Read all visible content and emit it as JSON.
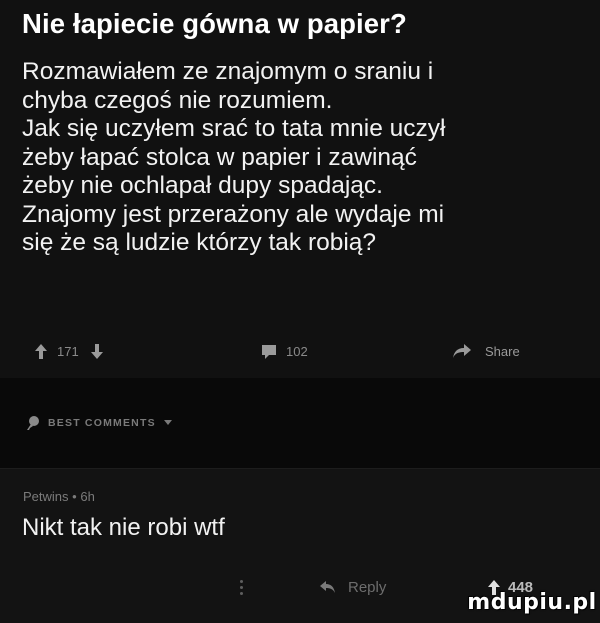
{
  "post": {
    "title": "Nie łapiecie gówna w papier?",
    "body": "Rozmawiałem ze znajomym o sraniu i\nchyba czegoś nie rozumiem.\nJak się uczyłem srać to tata mnie uczył\nżeby łapać stolca w papier i zawinąć\nżeby nie ochlapał dupy spadając.\nZnajomy jest przerażony ale wydaje mi\nsię że są ludzie którzy tak robią?",
    "upvotes": "171",
    "comments_count": "102",
    "share_label": "Share"
  },
  "best_comments": {
    "label": "BEST COMMENTS"
  },
  "comment": {
    "author": "Petwins",
    "age": "6h",
    "separator": "•",
    "text": "Nikt tak nie robi wtf",
    "reply_label": "Reply",
    "upvotes": "448"
  },
  "watermark": {
    "text": "mdupiu.pl"
  },
  "colors": {
    "background": "#0b0b0b",
    "post_background": "#111111",
    "muted_text": "#8a8a8a",
    "text": "#ffffff"
  },
  "icons": [
    "upvote-arrow-icon",
    "downvote-arrow-icon",
    "comment-bubble-icon",
    "share-arrow-icon",
    "award-icon",
    "chevron-down-icon",
    "reply-arrow-icon",
    "more-dots-icon"
  ]
}
